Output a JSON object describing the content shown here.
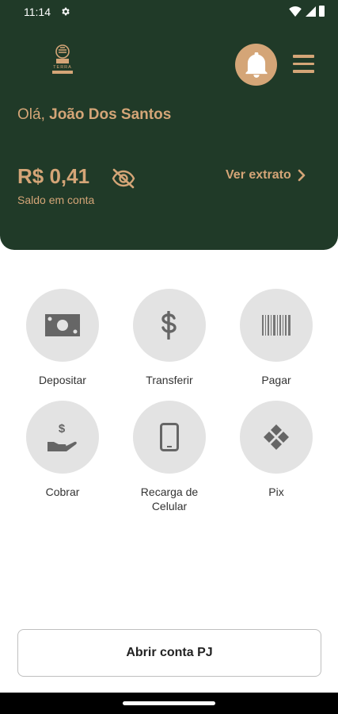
{
  "status_bar": {
    "time": "11:14",
    "icons": [
      "gear-icon",
      "wifi-icon",
      "signal-icon",
      "battery-icon"
    ]
  },
  "header": {
    "logo": "terra-logo",
    "logo_text": "TERRA",
    "greeting_prefix": "Olá, ",
    "user_name": "João Dos Santos",
    "balance": "R$ 0,41",
    "balance_label": "Saldo em conta",
    "statement_link": "Ver extrato",
    "colors": {
      "background": "#203a28",
      "accent": "#d4a577"
    }
  },
  "actions": [
    {
      "label": "Depositar",
      "icon": "cash-icon"
    },
    {
      "label": "Transferir",
      "icon": "dollar-icon"
    },
    {
      "label": "Pagar",
      "icon": "barcode-icon"
    },
    {
      "label": "Cobrar",
      "icon": "hand-dollar-icon"
    },
    {
      "label": "Recarga de\nCelular",
      "icon": "phone-icon"
    },
    {
      "label": "Pix",
      "icon": "pix-icon"
    }
  ],
  "footer": {
    "open_pj_label": "Abrir conta PJ"
  }
}
